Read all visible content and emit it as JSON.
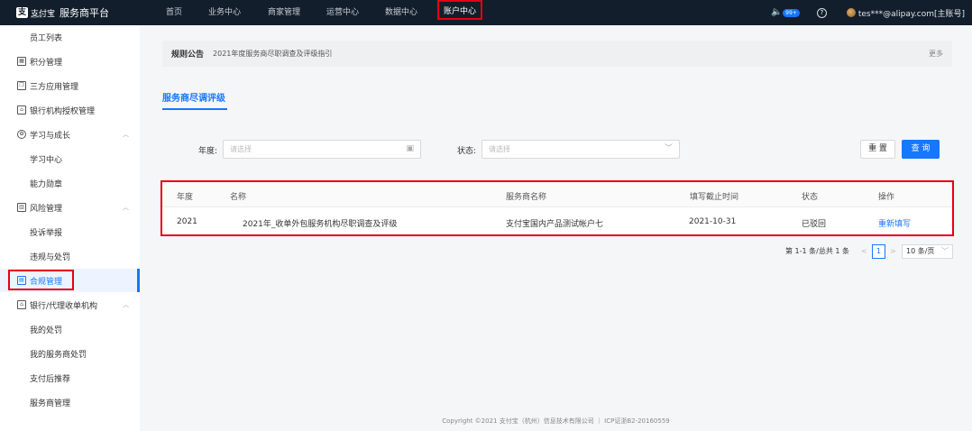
{
  "topbar": {
    "logo_text": "支付宝",
    "logo_sub": "ALIPAY",
    "platform_title": "服务商平台",
    "nav": [
      {
        "label": "首页"
      },
      {
        "label": "业务中心"
      },
      {
        "label": "商家管理"
      },
      {
        "label": "运营中心"
      },
      {
        "label": "数据中心"
      },
      {
        "label": "账户中心",
        "active": true
      }
    ],
    "notification_badge": "99+",
    "help_glyph": "?",
    "account": "tes***@alipay.com[主账号]"
  },
  "sidebar": {
    "items": [
      {
        "label": "员工列表",
        "type": "sub"
      },
      {
        "label": "积分管理",
        "type": "top",
        "icon": "points-icon"
      },
      {
        "label": "三方应用管理",
        "type": "top",
        "icon": "apps-icon"
      },
      {
        "label": "银行机构授权管理",
        "type": "top",
        "icon": "bank-icon"
      },
      {
        "label": "学习与成长",
        "type": "group",
        "icon": "learning-icon"
      },
      {
        "label": "学习中心",
        "type": "sub"
      },
      {
        "label": "能力勋章",
        "type": "sub"
      },
      {
        "label": "风险管理",
        "type": "group",
        "icon": "risk-icon"
      },
      {
        "label": "投诉举报",
        "type": "sub"
      },
      {
        "label": "违规与处罚",
        "type": "sub"
      },
      {
        "label": "合规管理",
        "type": "top",
        "icon": "compliance-icon",
        "selected": true
      },
      {
        "label": "银行/代理收单机构",
        "type": "group",
        "icon": "bank-icon"
      },
      {
        "label": "我的处罚",
        "type": "sub"
      },
      {
        "label": "我的服务商处罚",
        "type": "sub"
      },
      {
        "label": "支付后推荐",
        "type": "sub"
      },
      {
        "label": "服务商管理",
        "type": "sub"
      }
    ]
  },
  "notice": {
    "title": "规则公告",
    "text": "2021年度服务商尽职调查及评级指引",
    "more": "更多"
  },
  "tab": {
    "label": "服务商尽调评级"
  },
  "filters": {
    "year_label": "年度:",
    "year_placeholder": "请选择",
    "status_label": "状态:",
    "status_placeholder": "请选择"
  },
  "buttons": {
    "reset": "重 置",
    "query": "查 询"
  },
  "table": {
    "columns": [
      "年度",
      "名称",
      "服务商名称",
      "填写截止时间",
      "状态",
      "操作"
    ],
    "rows": [
      [
        "2021",
        "2021年_收单外包服务机构尽职调查及评级",
        "支付宝国内产品测试帐户七",
        "2021-10-31",
        "已驳回",
        "重新填写"
      ]
    ]
  },
  "pagination": {
    "total_text": "第 1-1 条/总共 1 条",
    "prev": "<",
    "current_page": "1",
    "next": ">",
    "page_size": "10 条/页"
  },
  "footer": {
    "text": "Copyright ©2021 支付宝（杭州）信息技术有限公司 ｜ ICP证浙B2-20160559"
  }
}
